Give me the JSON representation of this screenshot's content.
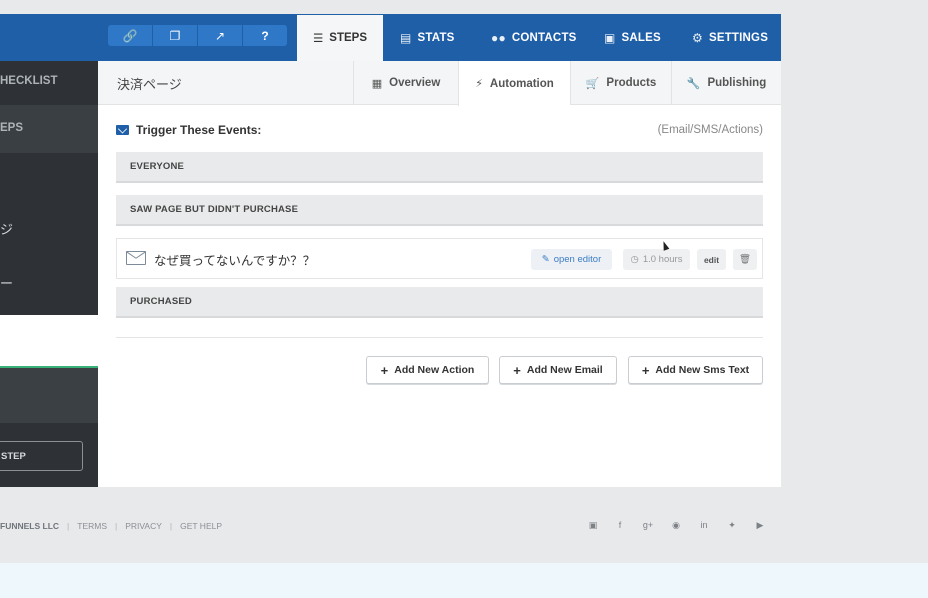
{
  "topnav": {
    "icon_buttons": [
      "link-icon",
      "clone-icon",
      "external-link-icon",
      "help-icon"
    ],
    "tabs": {
      "steps": "STEPS",
      "stats": "STATS",
      "contacts": "CONTACTS",
      "sales": "SALES",
      "settings": "SETTINGS"
    }
  },
  "sidebar": {
    "checklist": "HECKLIST",
    "steps": "EPS",
    "jp_item_1": "ジ",
    "jp_item_2": "ー",
    "new_step_button": "STEP"
  },
  "main": {
    "page_title": "決済ページ",
    "subtabs": {
      "overview": "Overview",
      "automation": "Automation",
      "products": "Products",
      "publishing": "Publishing"
    },
    "trigger_title": "Trigger These Events:",
    "trigger_note": "(Email/SMS/Actions)",
    "groups": {
      "everyone": "EVERYONE",
      "saw_page": "SAW PAGE BUT DIDN'T PURCHASE",
      "purchased": "PURCHASED"
    },
    "email_row": {
      "subject": "なぜ買ってないんですか？？",
      "open_editor": "open editor",
      "delay": "1.0 hours",
      "edit": "edit"
    },
    "buttons": {
      "add_action": "Add New Action",
      "add_email": "Add New Email",
      "add_sms": "Add New Sms Text"
    }
  },
  "footer": {
    "company": "FUNNELS LLC",
    "terms": "TERMS",
    "privacy": "PRIVACY",
    "help": "GET HELP",
    "social_icons": [
      "rss-icon",
      "facebook-icon",
      "google-plus-icon",
      "instagram-icon",
      "linkedin-icon",
      "twitter-icon",
      "youtube-icon"
    ]
  },
  "colors": {
    "nav_blue": "#1f5fa8",
    "sidebar_dark": "#2e3236",
    "accent_green": "#39b27a",
    "link_blue": "#3c7dc4"
  }
}
